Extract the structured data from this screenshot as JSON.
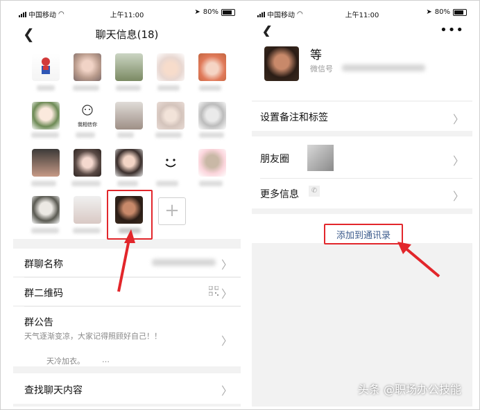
{
  "status": {
    "carrier": "中国移动",
    "time": "上午11:00",
    "battery": "80%"
  },
  "left": {
    "title": "聊天信息(18)",
    "rows": {
      "group_name": "群聊名称",
      "qr_code": "群二维码",
      "announcement": "群公告",
      "announcement_text": "天气逐渐变凉，大家记得照顾好自己！！",
      "announcement_text2": "天冷加衣。",
      "announcement_ellipsis": "…",
      "search": "查找聊天内容"
    },
    "member_caption": "我相信你"
  },
  "right": {
    "profile": {
      "name": "等",
      "wechat_id_label": "微信号"
    },
    "rows": {
      "remark": "设置备注和标签",
      "moments": "朋友圈",
      "more": "更多信息"
    },
    "add_contact": "添加到通讯录"
  },
  "watermark": "头条 @职场办公技能",
  "colors": {
    "highlight": "#e2262b",
    "link": "#3b5a8c"
  }
}
